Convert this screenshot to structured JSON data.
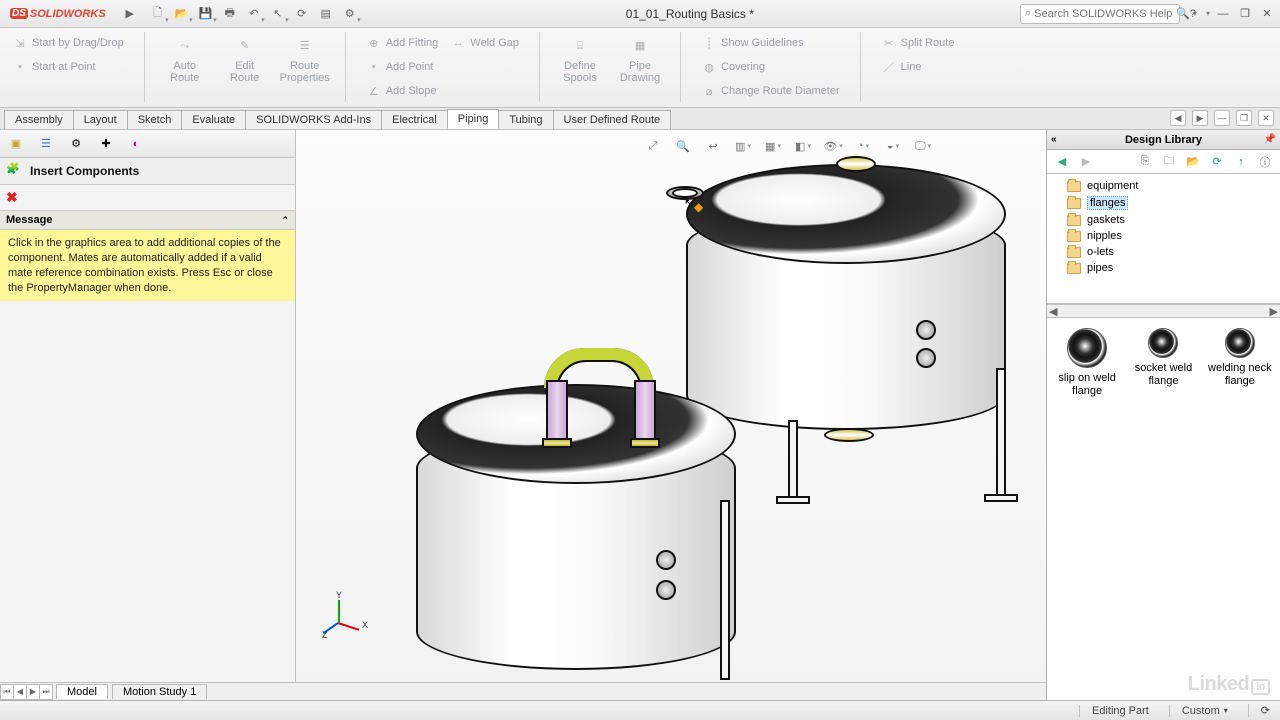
{
  "app": {
    "name": "SOLIDWORKS",
    "doc_title": "01_01_Routing Basics *"
  },
  "search": {
    "placeholder": "Search SOLIDWORKS Help"
  },
  "ribbon": {
    "start_drag": "Start by Drag/Drop",
    "start_point": "Start at Point",
    "auto_route": "Auto Route",
    "edit_route": "Edit Route",
    "route_props": "Route Properties",
    "add_fitting": "Add Fitting",
    "add_point": "Add Point",
    "add_slope": "Add Slope",
    "weld_gap": "Weld Gap",
    "define_spools": "Define Spools",
    "pipe_drawing": "Pipe Drawing",
    "show_guidelines": "Show Guidelines",
    "covering": "Covering",
    "change_diam": "Change Route Diameter",
    "split_route": "Split Route",
    "line": "Line"
  },
  "tabs": [
    "Assembly",
    "Layout",
    "Sketch",
    "Evaluate",
    "SOLIDWORKS Add-Ins",
    "Electrical",
    "Piping",
    "Tubing",
    "User Defined Route"
  ],
  "active_tab": "Piping",
  "pm": {
    "title": "Insert Components",
    "section": "Message",
    "msg": "Click in the graphics area to add additional copies of the component. Mates are automatically added if a valid mate reference combination exists. Press Esc or close the PropertyManager when done."
  },
  "design_library": {
    "title": "Design Library",
    "folders": [
      "equipment",
      "flanges",
      "gaskets",
      "nipples",
      "o-lets",
      "pipes"
    ],
    "selected_folder": "flanges",
    "items": [
      {
        "name": "slip on weld flange"
      },
      {
        "name": "socket weld flange"
      },
      {
        "name": "welding neck flange"
      }
    ]
  },
  "bottom_tabs": [
    "Model",
    "Motion Study 1"
  ],
  "status": {
    "mode": "Editing Part",
    "units": "Custom"
  },
  "triad": {
    "x": "X",
    "y": "Y",
    "z": "Z"
  },
  "watermark": "Linked in"
}
